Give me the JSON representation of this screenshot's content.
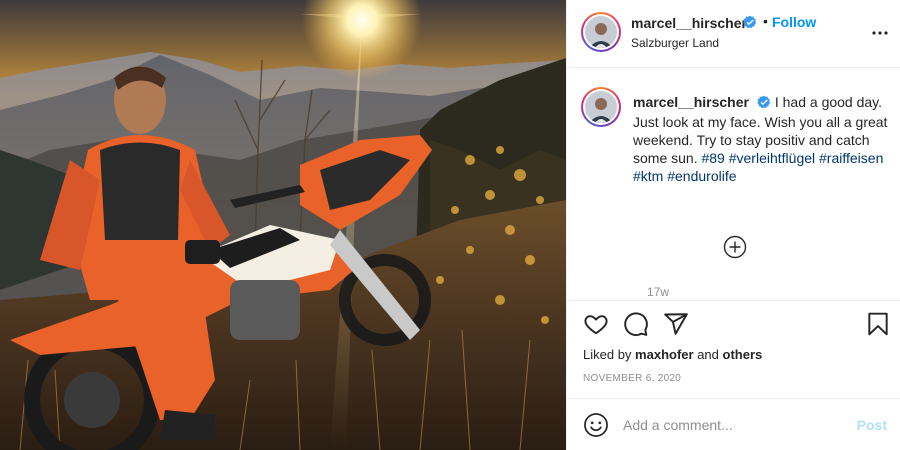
{
  "post": {
    "username": "marcel__hirscher",
    "verified": true,
    "follow_label": "Follow",
    "separator": "•",
    "location": "Salzburger Land",
    "more_icon": "more-horizontal-icon",
    "caption": {
      "text": "I had a good day. Just look at my face. Wish you all a great weekend. Try to stay positiv and catch some sun.",
      "hashtags": [
        "#89",
        "#verleihtflügel",
        "#raiffeisen",
        "#ktm",
        "#endurolife"
      ],
      "time_ago": "17w"
    },
    "load_more_icon": "plus-circle-icon",
    "actions": {
      "icons": [
        "heart-icon",
        "comment-icon",
        "share-icon",
        "bookmark-icon"
      ],
      "liked_by_prefix": "Liked by",
      "liked_by_user": "maxhofer",
      "liked_by_and": "and",
      "liked_by_others": "others",
      "date": "NOVEMBER 6, 2020"
    },
    "comment": {
      "placeholder": "Add a comment...",
      "post_label": "Post",
      "emoji_icon": "emoji-icon"
    }
  },
  "colors": {
    "accent": "#0095f6",
    "post_disabled": "#b2dffc",
    "verified": "#3897f0",
    "hashtag": "#00376b",
    "muted": "#8e8e8e",
    "jersey_orange": "#e8622a"
  }
}
